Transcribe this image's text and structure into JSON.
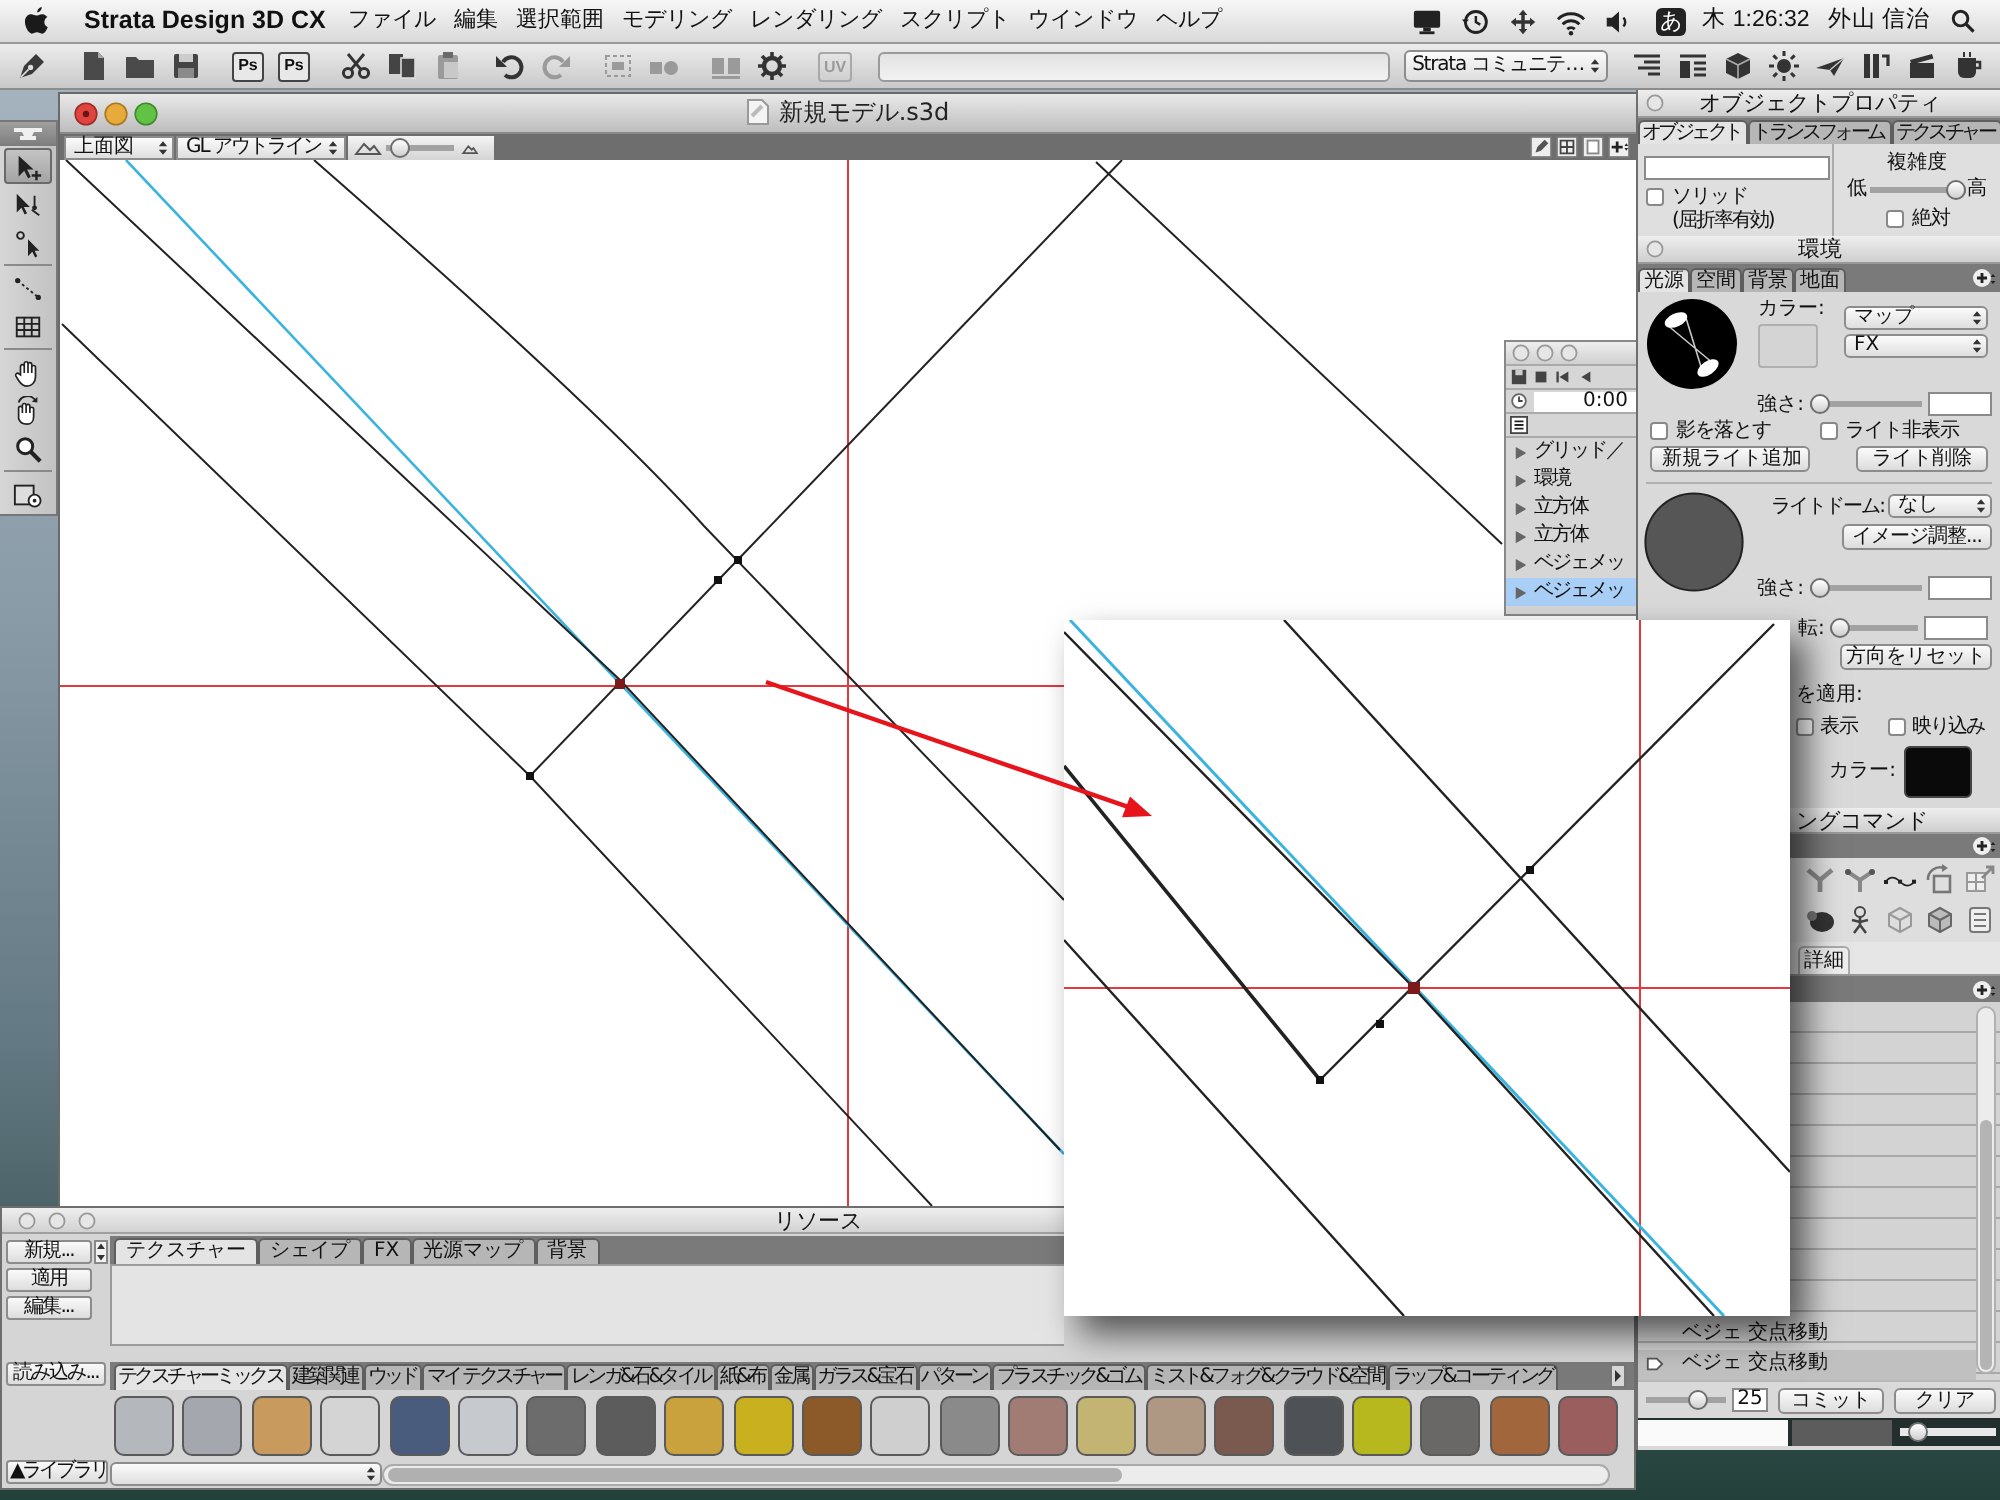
{
  "menu_bar": {
    "app_name": "Strata Design 3D CX",
    "menus": [
      "ファイル",
      "編集",
      "選択範囲",
      "モデリング",
      "レンダリング",
      "スクリプト",
      "ウインドウ",
      "ヘルプ"
    ],
    "input_mode": "あ",
    "clock": "木 1:26:32",
    "user": "外山 信治"
  },
  "toolbar": {
    "ps_buttons": [
      "Ps",
      "Ps"
    ],
    "uv_button": {
      "label": "UV",
      "disabled": true
    },
    "community_dropdown": "Strata コミュニテ…"
  },
  "tool_palette": {
    "tools": [
      {
        "selected": true
      },
      {
        "selected": false
      },
      {
        "selected": false
      },
      {
        "selected": false
      },
      {
        "selected": false
      },
      {
        "selected": false
      },
      {
        "selected": false
      },
      {
        "selected": false
      },
      {
        "selected": false
      }
    ]
  },
  "model_window": {
    "title": "新規モデル.s3d",
    "view_dropdown": "上面図",
    "render_dropdown": "GL アウトライン",
    "zoom_slider": {
      "level": 0.1
    }
  },
  "timeline_panel": {
    "time": "0:00",
    "items": [
      {
        "label": "グリッド／",
        "expanded": false,
        "selected": false
      },
      {
        "label": "環境",
        "expanded": false,
        "selected": false
      },
      {
        "label": "立方体",
        "expanded": false,
        "selected": false
      },
      {
        "label": "立方体",
        "expanded": false,
        "selected": false
      },
      {
        "label": "ベジェメッ",
        "expanded": false,
        "selected": false
      },
      {
        "label": "ベジェメッ",
        "expanded": false,
        "selected": true
      }
    ]
  },
  "object_properties": {
    "title": "オブジェクトプロパティ",
    "tabs": [
      {
        "label": "オブジェクト",
        "selected": true
      },
      {
        "label": "トランスフォーム",
        "selected": false
      },
      {
        "label": "テクスチャー",
        "selected": false
      }
    ],
    "solid": {
      "label": "ソリッド",
      "checked": false
    },
    "refraction_note": "(屈折率有効)",
    "complexity": {
      "label": "複雑度",
      "low": "低",
      "high": "高",
      "level": 1
    },
    "absolute": {
      "label": "絶対",
      "checked": false
    }
  },
  "environment": {
    "title": "環境",
    "tabs": [
      {
        "label": "光源",
        "selected": true
      },
      {
        "label": "空間",
        "selected": false
      },
      {
        "label": "背景",
        "selected": false
      },
      {
        "label": "地面",
        "selected": false
      }
    ],
    "color_label": "カラー:",
    "map_dropdown": "マップ",
    "fx_dropdown": "FX",
    "strength": {
      "label": "強さ:",
      "level": 0
    },
    "cast_shadow": {
      "label": "影を落とす",
      "checked": false
    },
    "hide_light": {
      "label": "ライト非表示",
      "checked": false
    },
    "add_light_button": "新規ライト追加",
    "delete_light_button": "ライト削除",
    "light_dome": {
      "label": "ライトドーム:",
      "value": "なし"
    },
    "image_adjust_button": "イメージ調整...",
    "dome_strength": {
      "label": "強さ:",
      "level": 0
    },
    "rotation": {
      "label": "転:",
      "level": 0
    },
    "reset_direction_button": "方向をリセット",
    "apply_label": "を適用:",
    "show": {
      "label": "表示",
      "checked": false
    },
    "reflection": {
      "label": "映り込み",
      "checked": false
    },
    "dome_color_label": "カラー:"
  },
  "commands_panel": {
    "title": "ングコマンド",
    "detail_tab": "詳細",
    "history": [
      {
        "label": "ベジェ 交点移動",
        "selected": false
      },
      {
        "label": "ベジェ 交点移動",
        "selected": true
      }
    ],
    "step_slider": {
      "level": 0.7
    },
    "step_value": "25",
    "commit_button": "コミット",
    "clear_button": "クリア",
    "preview_slider": {
      "level": 0.1
    }
  },
  "resources_window": {
    "title": "リソース",
    "side_buttons": [
      "新規...",
      "適用",
      "編集..."
    ],
    "load_button": "読み込み...",
    "library_button": "▲ライブラリ",
    "tabs": [
      {
        "label": "テクスチャー",
        "selected": true
      },
      {
        "label": "シェイプ",
        "selected": false
      },
      {
        "label": "FX",
        "selected": false
      },
      {
        "label": "光源マップ",
        "selected": false
      },
      {
        "label": "背景",
        "selected": false
      }
    ],
    "library_tabs": [
      {
        "label": "テクスチャーミックス",
        "selected": true
      },
      {
        "label": "建築関連",
        "selected": false
      },
      {
        "label": "ウッド",
        "selected": false
      },
      {
        "label": "マイ テクスチャー",
        "selected": false
      },
      {
        "label": "レンガ&石&タイル",
        "selected": false
      },
      {
        "label": "紙&布",
        "selected": false
      },
      {
        "label": "金属",
        "selected": false
      },
      {
        "label": "ガラス&宝石",
        "selected": false
      },
      {
        "label": "パターン",
        "selected": false
      },
      {
        "label": "プラスチック&ゴム",
        "selected": false
      },
      {
        "label": "ミスト&フォグ&クラウド&空間",
        "selected": false
      },
      {
        "label": "ラップ&コーティング",
        "selected": false
      }
    ],
    "textures": [
      {
        "color": "#b4b8bd"
      },
      {
        "color": "#a4a8ae"
      },
      {
        "color": "#c99a5e"
      },
      {
        "color": "#d4d4d4"
      },
      {
        "color": "#4a5c7e"
      },
      {
        "color": "#c6cacf"
      },
      {
        "color": "#6c6c6c"
      },
      {
        "color": "#5c5c5c"
      },
      {
        "color": "#c9a23e"
      },
      {
        "color": "#c8b01e"
      },
      {
        "color": "#8c5a28"
      },
      {
        "color": "#cfcfcf"
      },
      {
        "color": "#8a8a8a"
      },
      {
        "color": "#a07c74"
      },
      {
        "color": "#c4b474"
      },
      {
        "color": "#ae9884"
      },
      {
        "color": "#7a5a4e"
      },
      {
        "color": "#4e5256"
      },
      {
        "color": "#b6b81e"
      },
      {
        "color": "#6a6866"
      },
      {
        "color": "#a2663c"
      },
      {
        "color": "#9a5e5e"
      }
    ]
  }
}
